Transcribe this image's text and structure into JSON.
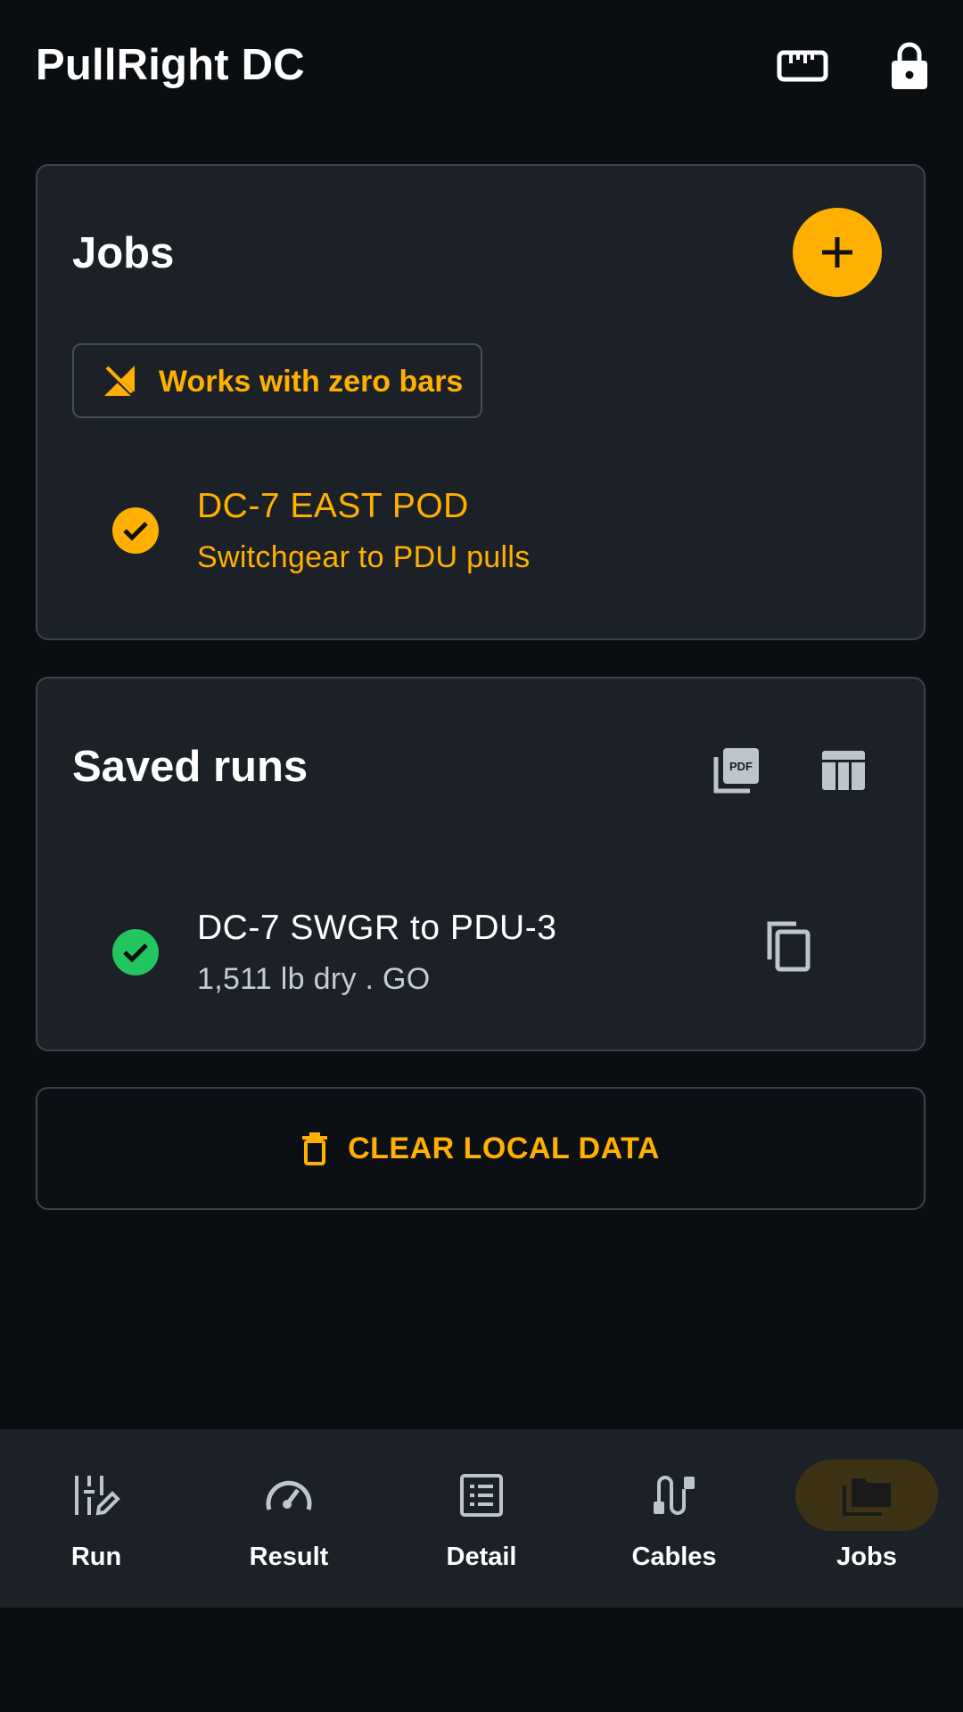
{
  "app": {
    "title": "PullRight DC"
  },
  "topbar": {
    "icons": [
      {
        "name": "ruler-icon"
      },
      {
        "name": "lock-icon"
      }
    ]
  },
  "jobs": {
    "title": "Jobs",
    "add_icon": "plus-icon",
    "offline_chip": {
      "icon": "no-signal-icon",
      "label": "Works with zero bars"
    },
    "items": [
      {
        "title": "DC-7 EAST POD",
        "subtitle": "Switchgear to PDU pulls",
        "status": "selected",
        "status_icon": "check-circle-icon"
      }
    ]
  },
  "saved_runs": {
    "title": "Saved runs",
    "actions": [
      {
        "icon": "pdf-icon"
      },
      {
        "icon": "table-icon"
      }
    ],
    "items": [
      {
        "title": "DC-7 SWGR to PDU-3",
        "subtitle": "1,511 lb dry . GO",
        "status": "go",
        "status_icon": "check-circle-icon",
        "action_icon": "copy-icon"
      }
    ]
  },
  "clear_button": {
    "label": "CLEAR LOCAL DATA",
    "icon": "trash-icon"
  },
  "bottom_nav": {
    "items": [
      {
        "label": "Run",
        "icon": "run-edit-icon",
        "active": false
      },
      {
        "label": "Result",
        "icon": "gauge-icon",
        "active": false
      },
      {
        "label": "Detail",
        "icon": "list-detail-icon",
        "active": false
      },
      {
        "label": "Cables",
        "icon": "cable-icon",
        "active": false
      },
      {
        "label": "Jobs",
        "icon": "folder-icon",
        "active": true
      }
    ]
  },
  "colors": {
    "background": "#0b0e11",
    "surface": "#1c2027",
    "accent": "#ffb000",
    "go": "#22c55e",
    "border": "#3b434d"
  }
}
